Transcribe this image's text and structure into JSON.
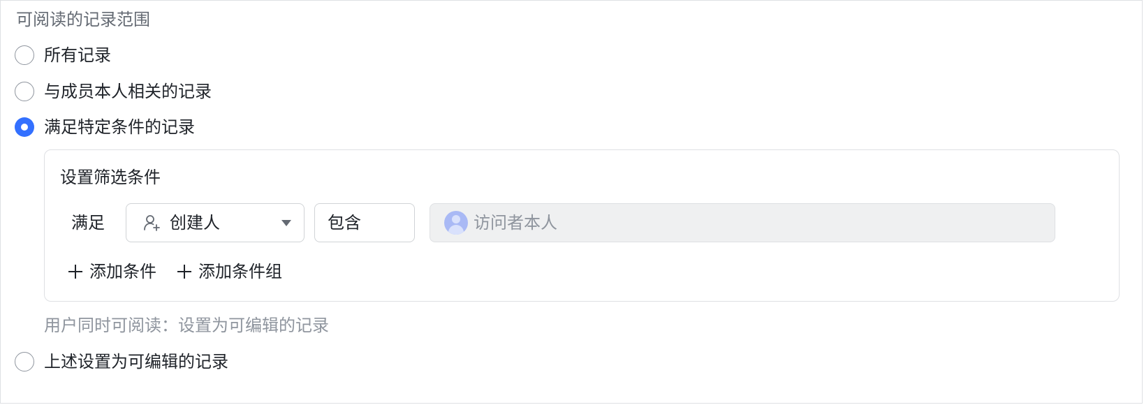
{
  "section": {
    "title": "可阅读的记录范围"
  },
  "options": [
    {
      "label": "所有记录",
      "checked": false
    },
    {
      "label": "与成员本人相关的记录",
      "checked": false
    },
    {
      "label": "满足特定条件的记录",
      "checked": true
    },
    {
      "label": "上述设置为可编辑的记录",
      "checked": false
    }
  ],
  "filter": {
    "title": "设置筛选条件",
    "match_label": "满足",
    "field": {
      "icon": "user-add-icon",
      "label": "创建人"
    },
    "operator": "包含",
    "value": {
      "label": "访问者本人"
    },
    "add_condition": "添加条件",
    "add_condition_group": "添加条件组"
  },
  "hint": "用户同时可阅读：设置为可编辑的记录",
  "colors": {
    "accent": "#3370ff",
    "text": "#1f2329",
    "muted": "#8f959e",
    "border": "#dee0e3"
  }
}
